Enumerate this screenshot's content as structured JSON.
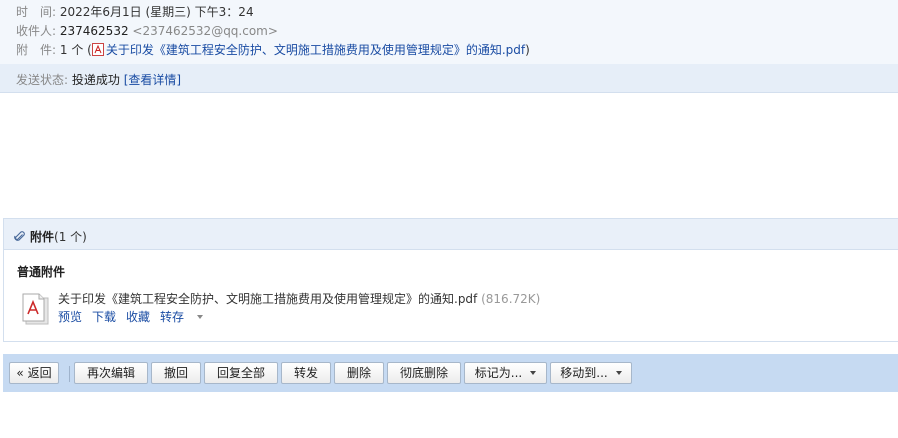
{
  "header": {
    "time_label": "时　间:",
    "time_value": "2022年6月1日 (星期三) 下午3：24",
    "recipient_label": "收件人:",
    "recipient_name": "237462532",
    "recipient_addr": "<237462532@qq.com>",
    "attach_label": "附　件:",
    "attach_count": "1 个 (",
    "attach_file": "关于印发《建筑工程安全防护、文明施工措施费用及使用管理规定》的通知.pdf",
    "attach_close": ")"
  },
  "status": {
    "label": "发送状态:",
    "value": "投递成功",
    "details": "[查看详情]"
  },
  "attachments": {
    "title": "附件",
    "count": "(1 个)",
    "section": "普通附件",
    "file_name": "关于印发《建筑工程安全防护、文明施工措施费用及使用管理规定》的通知.pdf",
    "file_size": "(816.72K)",
    "actions": [
      "预览",
      "下载",
      "收藏",
      "转存"
    ]
  },
  "toolbar": {
    "back": "« 返回",
    "reedit": "再次编辑",
    "recall": "撤回",
    "reply_all": "回复全部",
    "forward": "转发",
    "delete": "删除",
    "perm_delete": "彻底删除",
    "mark_as": "标记为...",
    "move_to": "移动到..."
  },
  "colors": {
    "link": "#1a4ca3",
    "toolbar_bg": "#c6daf2",
    "header_bg": "#f3f7fc"
  }
}
